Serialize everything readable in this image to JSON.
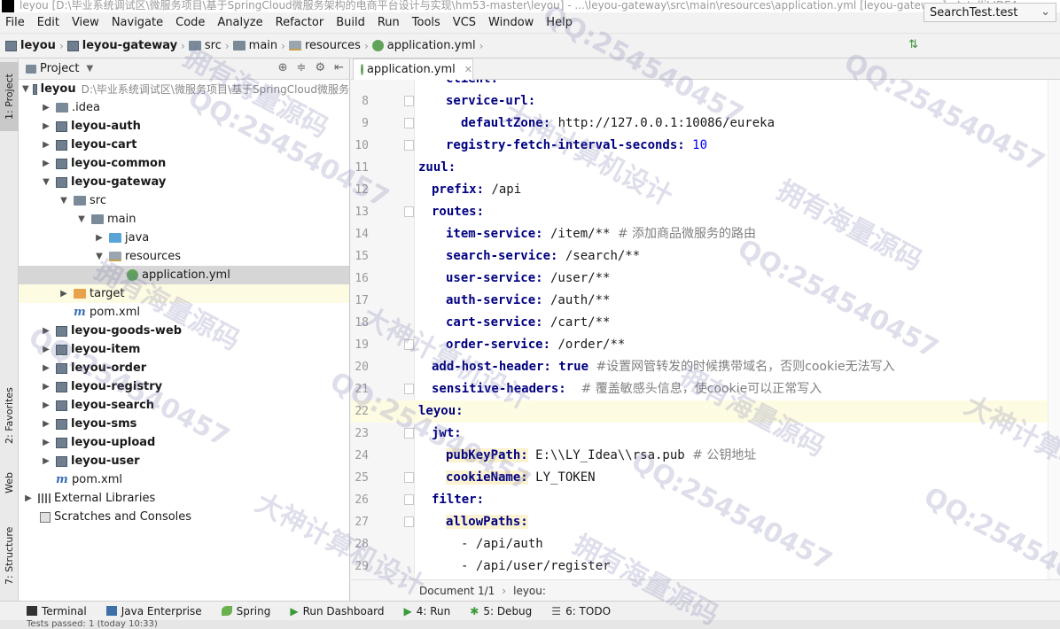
{
  "window": {
    "title": "leyou [D:\\毕业系统调试区\\微服务项目\\基于SpringCloud微服务架构的电商平台设计与实现\\hm53-master\\leyou] - ...\\leyou-gateway\\src\\main\\resources\\application.yml [leyou-gateway] - IntelliJ IDEA"
  },
  "menu": [
    "File",
    "Edit",
    "View",
    "Navigate",
    "Code",
    "Analyze",
    "Refactor",
    "Build",
    "Run",
    "Tools",
    "VCS",
    "Window",
    "Help"
  ],
  "breadcrumb": [
    "leyou",
    "leyou-gateway",
    "src",
    "main",
    "resources",
    "application.yml"
  ],
  "run_config": {
    "label": "SearchTest.test"
  },
  "side_tabs": {
    "project": "1: Project",
    "favorites": "2: Favorites",
    "web": "Web",
    "structure": "7: Structure"
  },
  "project_panel": {
    "title": "Project",
    "tree": [
      {
        "label": "leyou",
        "hint": "D:\\毕业系统调试区\\微服务项目\\基于SpringCloud微服务"
      },
      {
        "label": ".idea"
      },
      {
        "label": "leyou-auth"
      },
      {
        "label": "leyou-cart"
      },
      {
        "label": "leyou-common"
      },
      {
        "label": "leyou-gateway"
      },
      {
        "label": "src"
      },
      {
        "label": "main"
      },
      {
        "label": "java"
      },
      {
        "label": "resources"
      },
      {
        "label": "application.yml"
      },
      {
        "label": "target"
      },
      {
        "label": "pom.xml"
      },
      {
        "label": "leyou-goods-web"
      },
      {
        "label": "leyou-item"
      },
      {
        "label": "leyou-order"
      },
      {
        "label": "leyou-registry"
      },
      {
        "label": "leyou-search"
      },
      {
        "label": "leyou-sms"
      },
      {
        "label": "leyou-upload"
      },
      {
        "label": "leyou-user"
      },
      {
        "label": "pom.xml"
      },
      {
        "label": "External Libraries"
      },
      {
        "label": "Scratches and Consoles"
      }
    ]
  },
  "editor": {
    "tab": "application.yml",
    "partial_top": "client:",
    "lines": [
      {
        "n": "8",
        "key": "service-url:",
        "val": ""
      },
      {
        "n": "9",
        "key": "defaultZone:",
        "val": " http://127.0.0.1:10086/eureka"
      },
      {
        "n": "10",
        "key": "registry-fetch-interval-seconds:",
        "val": " 10"
      },
      {
        "n": "11",
        "key": "zuul:",
        "val": ""
      },
      {
        "n": "12",
        "key": "prefix:",
        "val": " /api"
      },
      {
        "n": "13",
        "key": "routes:",
        "val": ""
      },
      {
        "n": "14",
        "key": "item-service:",
        "val": " /item/** ",
        "cmt": "# 添加商品微服务的路由"
      },
      {
        "n": "15",
        "key": "search-service:",
        "val": " /search/**"
      },
      {
        "n": "16",
        "key": "user-service:",
        "val": " /user/**"
      },
      {
        "n": "17",
        "key": "auth-service:",
        "val": " /auth/**"
      },
      {
        "n": "18",
        "key": "cart-service:",
        "val": " /cart/**"
      },
      {
        "n": "19",
        "key": "order-service:",
        "val": " /order/**"
      },
      {
        "n": "20",
        "key": "add-host-header:",
        "val": " true ",
        "cmt": "#设置网管转发的时候携带域名，否则cookie无法写入"
      },
      {
        "n": "21",
        "key": "sensitive-headers:",
        "val": "  ",
        "cmt": "# 覆盖敏感头信息，使cookie可以正常写入"
      },
      {
        "n": "22",
        "key": "leyou:",
        "val": ""
      },
      {
        "n": "23",
        "key": "jwt:",
        "val": ""
      },
      {
        "n": "24",
        "key": "pubKeyPath:",
        "val": " E:\\\\LY_Idea\\\\rsa.pub ",
        "cmt": "# 公钥地址"
      },
      {
        "n": "25",
        "key": "cookieName:",
        "val": " LY_TOKEN"
      },
      {
        "n": "26",
        "key": "filter:",
        "val": ""
      },
      {
        "n": "27",
        "key": "allowPaths:",
        "val": ""
      },
      {
        "n": "28",
        "key": "",
        "val": "- /api/auth"
      },
      {
        "n": "29",
        "key": "",
        "val": "- /api/user/register"
      }
    ],
    "doc_status": {
      "document": "Document 1/1",
      "path": "leyou:"
    }
  },
  "bottom_tools": [
    "Terminal",
    "Java Enterprise",
    "Spring",
    "Run Dashboard",
    "4: Run",
    "5: Debug",
    "6: TODO"
  ],
  "status_text": "Tests passed: 1 (today 10:33)",
  "watermarks": [
    "QQ:254540457",
    "大神计算机设计",
    "拥有海量源码"
  ]
}
